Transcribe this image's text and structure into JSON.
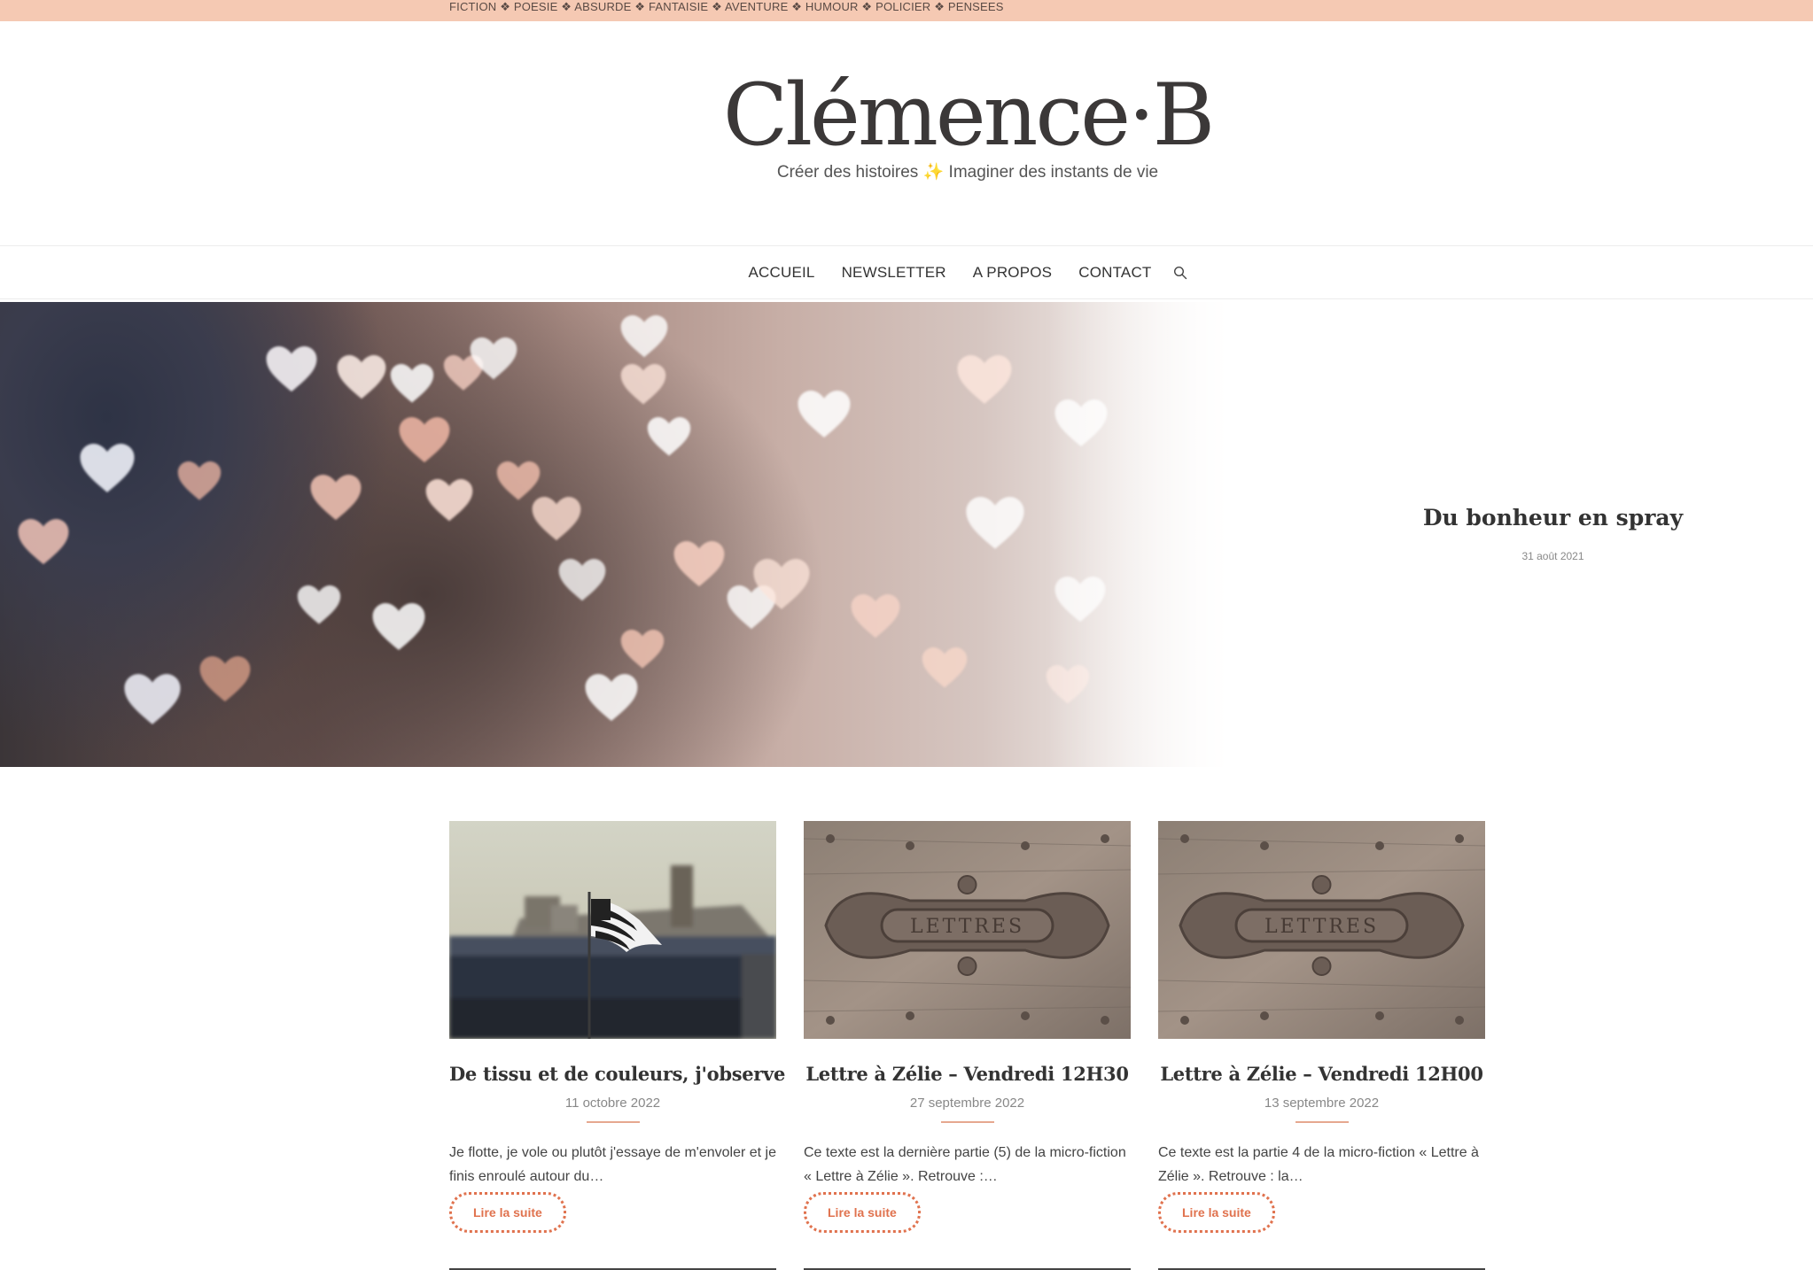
{
  "topbar": {
    "categories_text": "FICTION ❖ POESIE ❖ ABSURDE ❖ FANTAISIE ❖ AVENTURE ❖ HUMOUR ❖ POLICIER ❖ PENSEES"
  },
  "header": {
    "logo_text": "Clémence·B",
    "tagline_left": "Créer des histoires",
    "tagline_sparkle": "✨",
    "tagline_right": "Imaginer des instants de vie"
  },
  "nav": {
    "items": [
      {
        "label": "ACCUEIL"
      },
      {
        "label": "NEWSLETTER"
      },
      {
        "label": "A PROPOS"
      },
      {
        "label": "CONTACT"
      }
    ],
    "search_icon": "search-icon"
  },
  "hero": {
    "title": "Du bonheur en spray",
    "date": "31 août 2021"
  },
  "posts": [
    {
      "title": "De tissu et de couleurs, j'observe",
      "date": "11 octobre 2022",
      "excerpt": "Je flotte, je vole ou plutôt j'essaye de m'envoler et je finis enroulé autour du…",
      "read_more": "Lire la suite"
    },
    {
      "title": "Lettre à Zélie – Vendredi 12H30",
      "date": "27 septembre 2022",
      "excerpt": "Ce texte est la dernière partie (5) de la micro-fiction « Lettre à Zélie ». Retrouve :…",
      "read_more": "Lire la suite"
    },
    {
      "title": "Lettre à Zélie – Vendredi 12H00",
      "date": "13 septembre 2022",
      "excerpt": "Ce texte est la partie 4 de la micro-fiction « Lettre à Zélie ». Retrouve : la…",
      "read_more": "Lire la suite"
    }
  ],
  "colors": {
    "topbar": "#f5c9b3",
    "accent": "#e0724e"
  }
}
